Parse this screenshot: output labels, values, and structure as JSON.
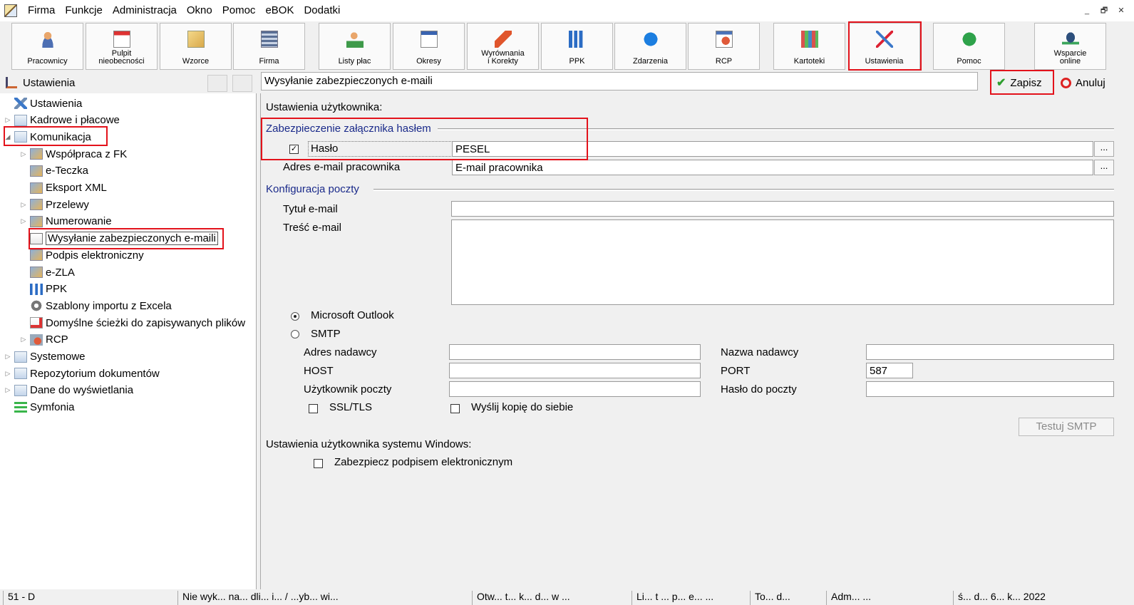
{
  "menu": [
    "Firma",
    "Funkcje",
    "Administracja",
    "Okno",
    "Pomoc",
    "eBOK",
    "Dodatki"
  ],
  "window_controls": [
    "_",
    "🗗",
    "✕"
  ],
  "toolbar": [
    {
      "label": "Pracownicy",
      "icon": "user-icon"
    },
    {
      "label": "Pulpit\nnieobecności",
      "icon": "calendar-icon"
    },
    {
      "label": "Wzorce",
      "icon": "templates-icon"
    },
    {
      "label": "Firma",
      "icon": "building-icon"
    },
    {
      "label": "Listy płac",
      "icon": "payroll-icon"
    },
    {
      "label": "Okresy",
      "icon": "periods-icon"
    },
    {
      "label": "Wyrównania\ni Korekty",
      "icon": "arrow-icon"
    },
    {
      "label": "PPK",
      "icon": "bar-chart-icon"
    },
    {
      "label": "Zdarzenia",
      "icon": "info-icon"
    },
    {
      "label": "RCP",
      "icon": "clock-icon"
    },
    {
      "label": "Kartoteki",
      "icon": "binders-icon"
    },
    {
      "label": "Ustawienia",
      "icon": "tools-icon"
    },
    {
      "label": "Pomoc",
      "icon": "help-icon"
    },
    {
      "label": "Wsparcie\nonline",
      "icon": "support-icon"
    }
  ],
  "left": {
    "header": "Ustawienia"
  },
  "tree": [
    {
      "label": "Ustawienia",
      "arrow": "",
      "icon": "tools-icon"
    },
    {
      "label": "Kadrowe i płacowe",
      "arrow": "▷",
      "icon": "folder-icon"
    },
    {
      "label": "Komunikacja",
      "arrow": "◢",
      "icon": "folder-icon"
    },
    {
      "label": "Współpraca z FK",
      "arrow": "▷",
      "icon": "fk-icon"
    },
    {
      "label": "e-Teczka",
      "arrow": "",
      "icon": "eteczka-icon"
    },
    {
      "label": "Eksport XML",
      "arrow": "",
      "icon": "xml-icon"
    },
    {
      "label": "Przelewy",
      "arrow": "▷",
      "icon": "transfer-icon"
    },
    {
      "label": "Numerowanie",
      "arrow": "▷",
      "icon": "numbering-icon"
    },
    {
      "label": "Wysyłanie zabezpieczonych e-maili",
      "arrow": "",
      "icon": "secure-mail-icon"
    },
    {
      "label": "Podpis elektroniczny",
      "arrow": "",
      "icon": "signature-icon"
    },
    {
      "label": "e-ZLA",
      "arrow": "",
      "icon": "ezla-icon"
    },
    {
      "label": "PPK",
      "arrow": "",
      "icon": "ppk-icon"
    },
    {
      "label": "Szablony importu z Excela",
      "arrow": "",
      "icon": "gear-icon"
    },
    {
      "label": "Domyślne ścieżki do zapisywanych plików",
      "arrow": "",
      "icon": "file-path-icon"
    },
    {
      "label": "RCP",
      "arrow": "▷",
      "icon": "rcp-icon"
    },
    {
      "label": "Systemowe",
      "arrow": "▷",
      "icon": "folder-icon"
    },
    {
      "label": "Repozytorium dokumentów",
      "arrow": "▷",
      "icon": "folder-icon"
    },
    {
      "label": "Dane do wyświetlania",
      "arrow": "▷",
      "icon": "folder-icon"
    },
    {
      "label": "Symfonia",
      "arrow": "",
      "icon": "symfonia-icon"
    }
  ],
  "right": {
    "title": "Wysyłanie zabezpieczonych e-maili",
    "save": "Zapisz",
    "cancel": "Anuluj",
    "user_settings": "Ustawienia użytkownika:",
    "section_pass": "Zabezpieczenie załącznika hasłem",
    "password_label": "Hasło",
    "password_value": "PESEL",
    "password_checked": true,
    "email_label": "Adres e-mail pracownika",
    "email_value": "E-mail pracownika",
    "section_mail": "Konfiguracja poczty",
    "subject_label": "Tytuł e-mail",
    "subject_value": "",
    "body_label": "Treść e-mail",
    "body_value": "",
    "outlook": "Microsoft Outlook",
    "smtp": "SMTP",
    "selected_client": "Microsoft Outlook",
    "sender_addr": "Adres nadawcy",
    "sender_name": "Nazwa nadawcy",
    "host": "HOST",
    "port": "PORT",
    "port_value": "587",
    "mail_user": "Użytkownik poczty",
    "mail_pass": "Hasło do poczty",
    "ssl": "SSL/TLS",
    "copy_self": "Wyślij kopię do siebie",
    "test_smtp": "Testuj SMTP",
    "windows_settings": "Ustawienia użytkownika systemu Windows:",
    "sign": "Zabezpiecz podpisem elektronicznym"
  },
  "status": [
    "51 - D",
    "Nie wyk... na... dli... i... / ...yb... wi...",
    "Otw... t... k... d... w ...",
    "Li... t ... p... e... ...",
    "To... d...",
    "Adm... ...",
    "ś... d... 6... k... 2022"
  ],
  "colors": {
    "highlight": "#e3121b",
    "section": "#1a2a8a",
    "save_check": "#2e9e2e"
  }
}
